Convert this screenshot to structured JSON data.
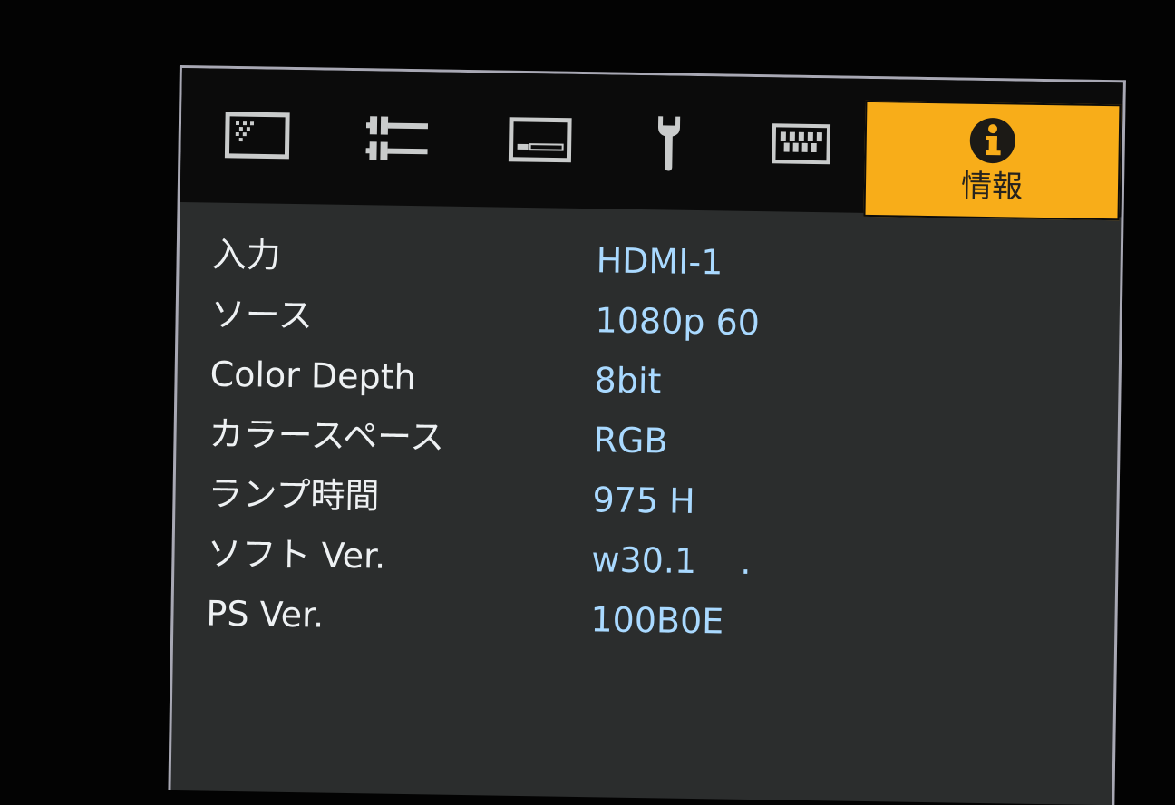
{
  "tabs": [
    {
      "icon": "picture-icon"
    },
    {
      "icon": "sliders-icon"
    },
    {
      "icon": "display-icon"
    },
    {
      "icon": "wrench-icon"
    },
    {
      "icon": "keyboard-icon"
    },
    {
      "icon": "info-icon",
      "label": "情報",
      "active": true
    }
  ],
  "info": {
    "rows": [
      {
        "label": "入力",
        "value": "HDMI-1"
      },
      {
        "label": "ソース",
        "value": "1080p 60"
      },
      {
        "label": "Color Depth",
        "value": "8bit"
      },
      {
        "label": "カラースペース",
        "value": "RGB"
      },
      {
        "label": "ランプ時間",
        "value": "975 H"
      },
      {
        "label": "ソフト Ver.",
        "value": "w30.1    ."
      },
      {
        "label": "PS Ver.",
        "value": "100B0E"
      }
    ]
  },
  "colors": {
    "accent": "#f8ad19",
    "panel": "#2b2d2d",
    "label_text": "#eef1f3",
    "value_text": "#a9d9ff"
  }
}
